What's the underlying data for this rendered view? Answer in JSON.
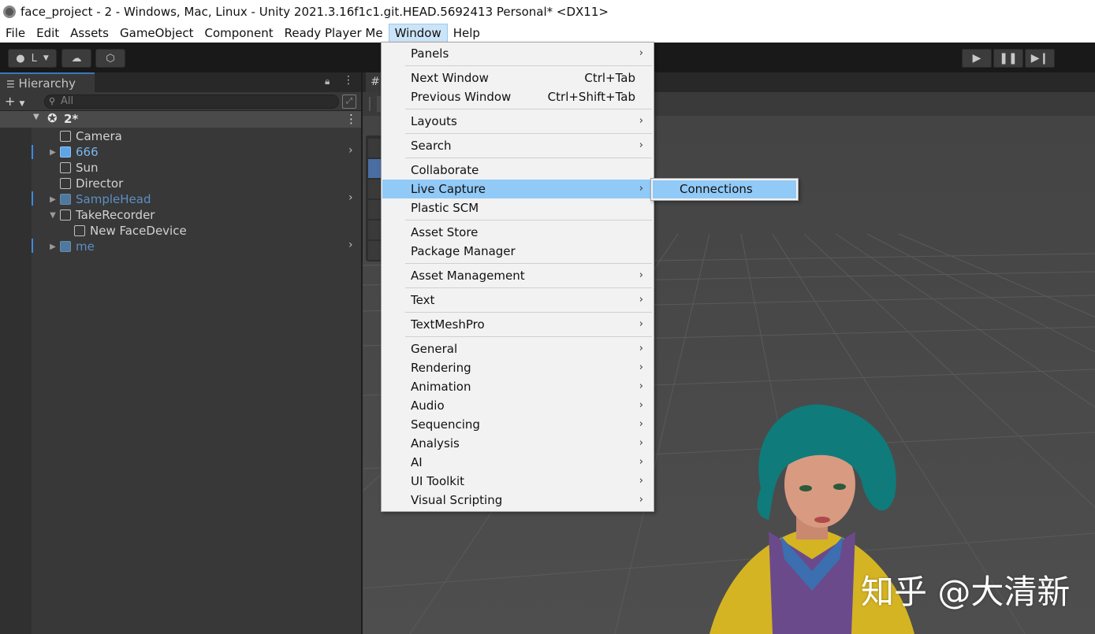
{
  "window": {
    "title": "face_project - 2 - Windows, Mac, Linux - Unity 2021.3.16f1c1.git.HEAD.5692413 Personal* <DX11>"
  },
  "menubar": [
    "File",
    "Edit",
    "Assets",
    "GameObject",
    "Component",
    "Ready Player Me",
    "Window",
    "Help"
  ],
  "toolbar": {
    "account_label": "L"
  },
  "hierarchy": {
    "tab_label": "Hierarchy",
    "search_placeholder": "All",
    "scene_name": "2*",
    "items": [
      {
        "label": "Camera"
      },
      {
        "label": "666"
      },
      {
        "label": "Sun"
      },
      {
        "label": "Director"
      },
      {
        "label": "SampleHead"
      },
      {
        "label": "TakeRecorder"
      },
      {
        "label": "New FaceDevice"
      },
      {
        "label": "me"
      }
    ]
  },
  "scene_view": {
    "tab_glyph": "#"
  },
  "window_menu": {
    "items": [
      {
        "label": "Panels"
      },
      {
        "label": "Next Window",
        "shortcut": "Ctrl+Tab"
      },
      {
        "label": "Previous Window",
        "shortcut": "Ctrl+Shift+Tab"
      },
      {
        "label": "Layouts"
      },
      {
        "label": "Search"
      },
      {
        "label": "Collaborate"
      },
      {
        "label": "Live Capture"
      },
      {
        "label": "Plastic SCM"
      },
      {
        "label": "Asset Store"
      },
      {
        "label": "Package Manager"
      },
      {
        "label": "Asset Management"
      },
      {
        "label": "Text"
      },
      {
        "label": "TextMeshPro"
      },
      {
        "label": "General"
      },
      {
        "label": "Rendering"
      },
      {
        "label": "Animation"
      },
      {
        "label": "Audio"
      },
      {
        "label": "Sequencing"
      },
      {
        "label": "Analysis"
      },
      {
        "label": "AI"
      },
      {
        "label": "UI Toolkit"
      },
      {
        "label": "Visual Scripting"
      }
    ],
    "submenu_glyph": "›"
  },
  "live_capture_submenu": {
    "items": [
      "Connections"
    ]
  },
  "watermark": "知乎 @大清新",
  "colors": {
    "menu_highlight": "#91c9f7",
    "prefab_blue": "#7ab6ee",
    "editor_dark": "#383838"
  }
}
